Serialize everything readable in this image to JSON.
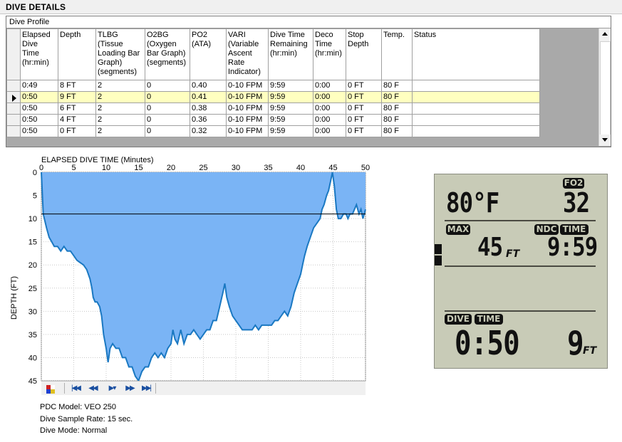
{
  "window": {
    "title": "DIVE DETAILS"
  },
  "grid": {
    "caption": "Dive Profile",
    "columns": [
      {
        "label": "Elapsed Dive Time (hr:min)",
        "width": 48
      },
      {
        "label": "Depth",
        "width": 48
      },
      {
        "label": "TLBG (Tissue Loading Bar Graph) (segments)",
        "width": 64
      },
      {
        "label": "O2BG (Oxygen Bar Graph) (segments)",
        "width": 58
      },
      {
        "label": "PO2 (ATA)",
        "width": 46
      },
      {
        "label": "VARI (Variable Ascent Rate Indicator)",
        "width": 54
      },
      {
        "label": "Dive Time Remaining (hr:min)",
        "width": 58
      },
      {
        "label": "Deco Time (hr:min)",
        "width": 41
      },
      {
        "label": "Stop Depth",
        "width": 45
      },
      {
        "label": "Temp.",
        "width": 38
      },
      {
        "label": "Status",
        "width": 174
      }
    ],
    "current_row": 1,
    "rows": [
      [
        "0:49",
        "8 FT",
        "2",
        "0",
        "0.40",
        "0-10 FPM",
        "9:59",
        "0:00",
        "0 FT",
        "80 F",
        ""
      ],
      [
        "0:50",
        "9 FT",
        "2",
        "0",
        "0.41",
        "0-10 FPM",
        "9:59",
        "0:00",
        "0 FT",
        "80 F",
        ""
      ],
      [
        "0:50",
        "6 FT",
        "2",
        "0",
        "0.38",
        "0-10 FPM",
        "9:59",
        "0:00",
        "0 FT",
        "80 F",
        ""
      ],
      [
        "0:50",
        "4 FT",
        "2",
        "0",
        "0.36",
        "0-10 FPM",
        "9:59",
        "0:00",
        "0 FT",
        "80 F",
        ""
      ],
      [
        "0:50",
        "0 FT",
        "2",
        "0",
        "0.32",
        "0-10 FPM",
        "9:59",
        "0:00",
        "0 FT",
        "80 F",
        ""
      ]
    ]
  },
  "chart_data": {
    "type": "area",
    "title": "ELAPSED DIVE TIME (Minutes)",
    "xlabel": "ELAPSED DIVE TIME (Minutes)",
    "ylabel": "DEPTH (FT)",
    "xlim": [
      0,
      50
    ],
    "ylim": [
      0,
      45
    ],
    "x_ticks": [
      0,
      5,
      10,
      15,
      20,
      25,
      30,
      35,
      40,
      45,
      50
    ],
    "y_ticks": [
      0,
      5,
      10,
      15,
      20,
      25,
      30,
      35,
      40,
      45
    ],
    "y_inverted": true,
    "grid": true,
    "cursor_depth": 9,
    "fill_color": "#7ab4f5",
    "line_color": "#1a78c2",
    "points": [
      [
        0,
        0
      ],
      [
        0.3,
        9
      ],
      [
        0.8,
        12
      ],
      [
        1.2,
        14
      ],
      [
        1.6,
        15
      ],
      [
        2,
        16
      ],
      [
        2.5,
        16
      ],
      [
        3,
        17
      ],
      [
        3.5,
        16
      ],
      [
        4,
        17
      ],
      [
        4.5,
        17
      ],
      [
        5,
        18
      ],
      [
        5.5,
        19
      ],
      [
        6,
        19.5
      ],
      [
        6.5,
        20
      ],
      [
        7,
        21
      ],
      [
        7.5,
        23
      ],
      [
        7.8,
        25
      ],
      [
        8,
        27
      ],
      [
        8.3,
        28
      ],
      [
        8.6,
        28
      ],
      [
        9,
        29
      ],
      [
        9.3,
        31
      ],
      [
        9.6,
        35
      ],
      [
        10,
        38
      ],
      [
        10.3,
        41
      ],
      [
        10.6,
        38
      ],
      [
        11,
        37
      ],
      [
        11.5,
        38
      ],
      [
        12,
        38
      ],
      [
        12.5,
        40
      ],
      [
        13,
        40
      ],
      [
        13.5,
        42
      ],
      [
        14,
        42
      ],
      [
        14.5,
        44
      ],
      [
        15,
        45
      ],
      [
        15.5,
        43
      ],
      [
        16,
        42
      ],
      [
        16.5,
        42
      ],
      [
        17,
        40
      ],
      [
        17.5,
        39
      ],
      [
        18,
        40
      ],
      [
        18.5,
        39
      ],
      [
        19,
        40
      ],
      [
        19.5,
        38
      ],
      [
        20,
        37
      ],
      [
        20.3,
        34
      ],
      [
        20.6,
        36
      ],
      [
        21,
        37
      ],
      [
        21.5,
        34
      ],
      [
        22,
        37
      ],
      [
        22.5,
        35
      ],
      [
        23,
        35
      ],
      [
        23.5,
        34
      ],
      [
        24,
        35
      ],
      [
        24.5,
        36
      ],
      [
        25,
        35
      ],
      [
        25.5,
        34
      ],
      [
        26,
        34
      ],
      [
        26.5,
        32
      ],
      [
        27,
        32
      ],
      [
        27.5,
        29
      ],
      [
        28,
        26
      ],
      [
        28.3,
        24
      ],
      [
        28.6,
        27
      ],
      [
        29,
        29
      ],
      [
        29.5,
        31
      ],
      [
        30,
        32
      ],
      [
        30.5,
        33
      ],
      [
        31,
        34
      ],
      [
        31.5,
        34
      ],
      [
        32,
        34
      ],
      [
        32.5,
        34
      ],
      [
        33,
        33
      ],
      [
        33.5,
        34
      ],
      [
        34,
        33
      ],
      [
        34.5,
        33
      ],
      [
        35,
        33
      ],
      [
        35.5,
        33
      ],
      [
        36,
        32
      ],
      [
        36.5,
        32
      ],
      [
        37,
        31
      ],
      [
        37.5,
        30
      ],
      [
        38,
        31
      ],
      [
        38.5,
        29
      ],
      [
        39,
        26
      ],
      [
        39.5,
        24
      ],
      [
        40,
        22
      ],
      [
        40.3,
        20
      ],
      [
        40.6,
        18
      ],
      [
        41,
        16
      ],
      [
        41.5,
        14
      ],
      [
        42,
        12
      ],
      [
        42.5,
        11
      ],
      [
        43,
        10
      ],
      [
        43.3,
        8
      ],
      [
        43.6,
        7
      ],
      [
        44,
        5
      ],
      [
        44.3,
        4
      ],
      [
        44.6,
        2
      ],
      [
        44.9,
        0
      ],
      [
        45.2,
        3
      ],
      [
        45.5,
        8
      ],
      [
        45.8,
        10
      ],
      [
        46.2,
        10
      ],
      [
        46.6,
        9
      ],
      [
        47,
        9
      ],
      [
        47.3,
        10
      ],
      [
        47.6,
        9
      ],
      [
        48,
        9
      ],
      [
        48.3,
        8
      ],
      [
        48.6,
        7
      ],
      [
        49,
        9
      ],
      [
        49.3,
        8
      ],
      [
        49.6,
        10
      ],
      [
        50,
        8
      ]
    ]
  },
  "toolbar": {
    "buttons": [
      {
        "name": "palette-button",
        "glyph": ""
      },
      {
        "name": "first-button",
        "glyph": "|◀◀"
      },
      {
        "name": "rewind-button",
        "glyph": "◀◀"
      },
      {
        "name": "play-button",
        "glyph": "▶▾"
      },
      {
        "name": "forward-button",
        "glyph": "▶▶"
      },
      {
        "name": "last-button",
        "glyph": "▶▶|"
      }
    ]
  },
  "info": {
    "pdc_model": "PDC Model: VEO 250",
    "sample_rate": "Dive Sample Rate: 15 sec.",
    "dive_mode": "Dive Mode: Normal"
  },
  "lcd": {
    "temperature": "80°F",
    "fo2_label": "FO2",
    "fo2_value": "32",
    "max_label": "MAX",
    "max_depth": "45",
    "max_unit": "FT",
    "ndc_label": "NDC",
    "time_label": "TIME",
    "ndc_time": "9:59",
    "dive_label": "DIVE",
    "dive_time_label": "TIME",
    "elapsed_time": "0:50",
    "current_depth": "9",
    "current_unit": "FT",
    "colors": {
      "background": "#c8cbb7",
      "segment": "#111111"
    }
  }
}
